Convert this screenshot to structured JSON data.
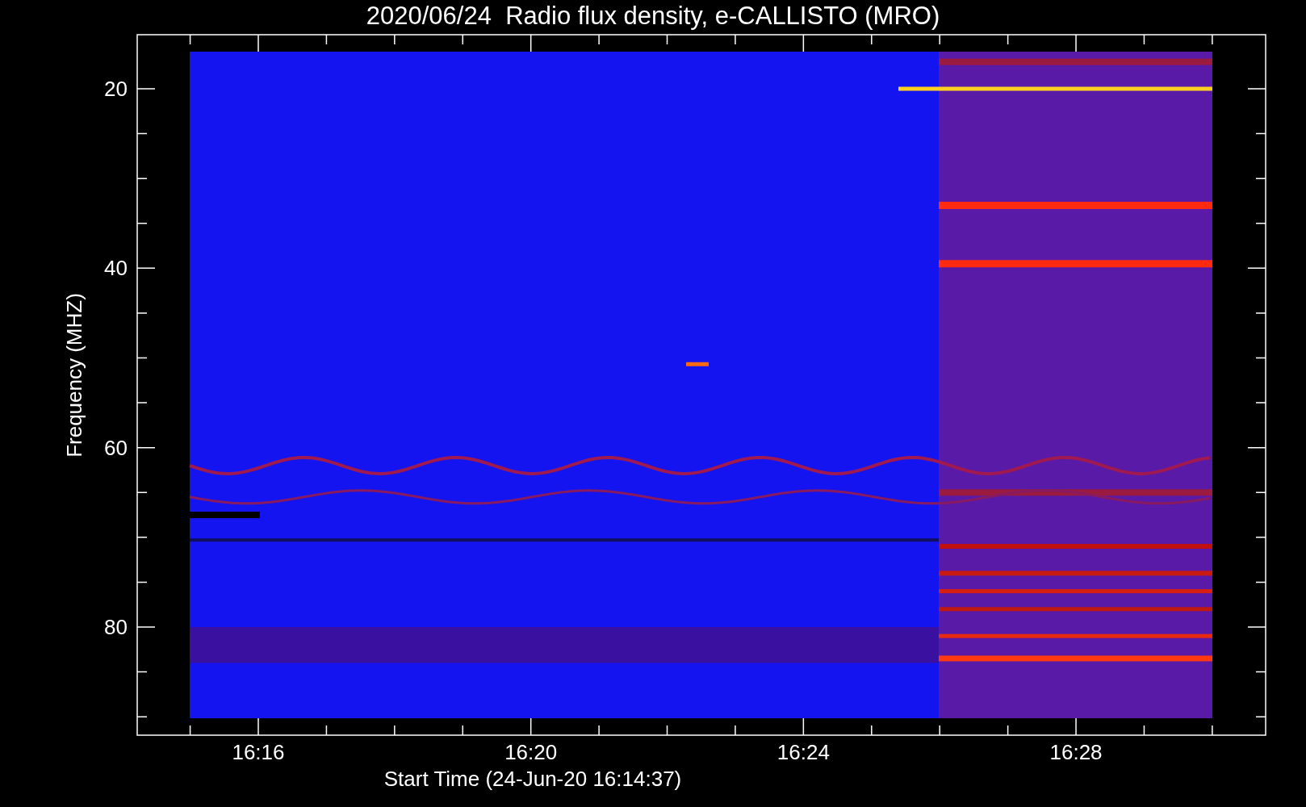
{
  "plot": {
    "title": "2020/06/24  Radio flux density, e-CALLISTO (MRO)",
    "ylabel": "Frequency (MHZ)",
    "xlabel": "Start Time (24-Jun-20 16:14:37)",
    "yticks": [
      "20",
      "40",
      "60",
      "80"
    ],
    "xticks": [
      "16:16",
      "16:20",
      "16:24",
      "16:28"
    ]
  }
}
